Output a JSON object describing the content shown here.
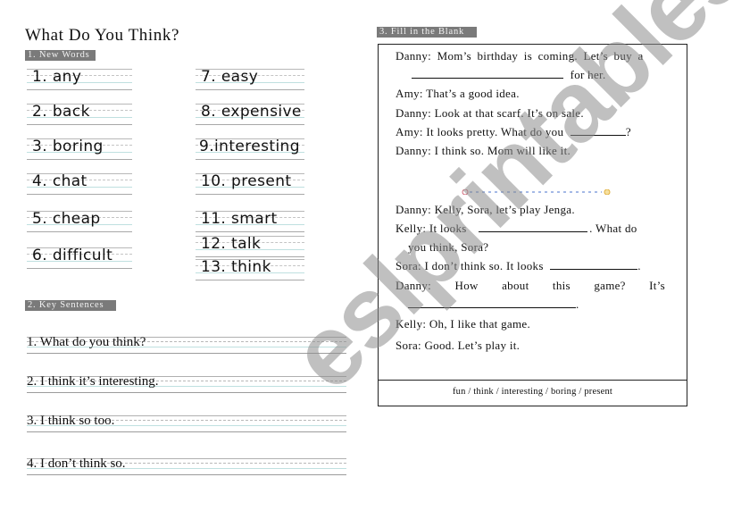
{
  "title": "What Do You Think?",
  "sections": {
    "new_words": {
      "label": "1. New Words",
      "words": [
        "1. any",
        "2. back",
        "3. boring",
        "4. chat",
        "5. cheap",
        "6. difficult",
        "7. easy",
        "8. expensive",
        "9.interesting",
        "10. present",
        "11. smart",
        "12. talk",
        "13. think"
      ]
    },
    "key_sentences": {
      "label": "2. Key Sentences",
      "sentences": [
        "1. What do you think?",
        "2. I think it’s interesting.",
        "3. I think so too.",
        "4. I don’t think so."
      ]
    },
    "fill_blank": {
      "label": "3. Fill in the Blank",
      "dialogue1": [
        "Danny: Mom’s birthday is coming. Let’s buy a",
        "for her.",
        "Amy: That’s a good idea.",
        "Danny: Look at that scarf. It’s on sale.",
        "Amy: It looks pretty. What do you",
        "?",
        "Danny: I think so. Mom will like it."
      ],
      "dialogue2": [
        "Danny: Kelly, Sora, let’s play Jenga.",
        "Kelly: It looks",
        ". What do",
        "you think, Sora?",
        "Sora: I don’t think so. It looks",
        ".",
        "Danny:",
        "How",
        "about",
        "this",
        "game?",
        "It’s",
        ".",
        "Kelly: Oh, I like that game.",
        "Sora: Good. Let’s play it."
      ],
      "word_bank": "fun / think / interesting / boring / present"
    }
  },
  "watermark": "eslprintables.com",
  "colors": {
    "tag_bg": "#7a7a7a",
    "separator_dots": "#6d8fd8",
    "separator_left_icon": "#d06a7a",
    "separator_right_icon": "#e0b040"
  }
}
